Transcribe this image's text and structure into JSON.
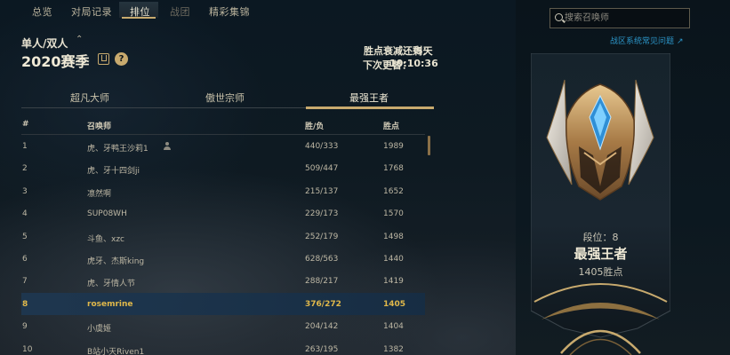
{
  "nav": {
    "tabs": [
      {
        "label": "总览"
      },
      {
        "label": "对局记录"
      },
      {
        "label": "排位"
      },
      {
        "label": "战团"
      },
      {
        "label": "精彩集锦"
      }
    ]
  },
  "queue": {
    "label": "单人/双人",
    "season": "2020赛季"
  },
  "decay": {
    "label": "胜点衰减还剩：",
    "value": "5天"
  },
  "update": {
    "label": "下次更替：",
    "value": "10:10:36"
  },
  "tiers": [
    {
      "label": "超凡大师"
    },
    {
      "label": "傲世宗师"
    },
    {
      "label": "最强王者"
    }
  ],
  "table": {
    "headers": {
      "rank": "#",
      "name": "召唤师",
      "wl": "胜/负",
      "lp": "胜点"
    },
    "rows": [
      {
        "rank": "1",
        "name": "虎、牙鸭王沙莉1",
        "wl": "440/333",
        "lp": "1989"
      },
      {
        "rank": "2",
        "name": "虎、牙十四剑ji",
        "wl": "509/447",
        "lp": "1768"
      },
      {
        "rank": "3",
        "name": "凛然啊",
        "wl": "215/137",
        "lp": "1652"
      },
      {
        "rank": "4",
        "name": "SUP08WH",
        "wl": "229/173",
        "lp": "1570"
      },
      {
        "rank": "5",
        "name": "斗鱼、xzc",
        "wl": "252/179",
        "lp": "1498"
      },
      {
        "rank": "6",
        "name": "虎牙、杰斯king",
        "wl": "628/563",
        "lp": "1440"
      },
      {
        "rank": "7",
        "name": "虎、牙情人节",
        "wl": "288/217",
        "lp": "1419"
      },
      {
        "rank": "8",
        "name": "rosemrine",
        "wl": "376/272",
        "lp": "1405"
      },
      {
        "rank": "9",
        "name": "小虞姬",
        "wl": "204/142",
        "lp": "1404"
      },
      {
        "rank": "10",
        "name": "B站小天Riven1",
        "wl": "263/195",
        "lp": "1382"
      }
    ]
  },
  "search": {
    "placeholder": "搜索召唤师"
  },
  "faq": {
    "label": "战区系统常见问题"
  },
  "player": {
    "rank_label": "段位：8",
    "tier": "最强王者",
    "lp": "1405胜点"
  },
  "colors": {
    "gold": "#c8aa6e",
    "highlight_text": "#e0b84a",
    "link": "#2b95c8",
    "highlight_row": "#1e3750"
  }
}
